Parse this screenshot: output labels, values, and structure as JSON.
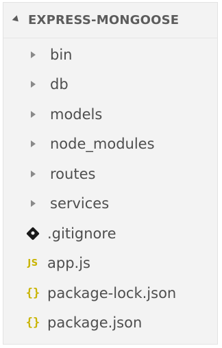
{
  "explorer": {
    "root_label": "EXPRESS-MONGOOSE",
    "items": [
      {
        "label": "bin",
        "kind": "folder",
        "icon": "chevron-right-icon"
      },
      {
        "label": "db",
        "kind": "folder",
        "icon": "chevron-right-icon"
      },
      {
        "label": "models",
        "kind": "folder",
        "icon": "chevron-right-icon"
      },
      {
        "label": "node_modules",
        "kind": "folder",
        "icon": "chevron-right-icon"
      },
      {
        "label": "routes",
        "kind": "folder",
        "icon": "chevron-right-icon"
      },
      {
        "label": "services",
        "kind": "folder",
        "icon": "chevron-right-icon"
      },
      {
        "label": ".gitignore",
        "kind": "file",
        "icon": "git-icon"
      },
      {
        "label": "app.js",
        "kind": "file",
        "icon": "js-icon",
        "icon_text": "JS"
      },
      {
        "label": "package-lock.json",
        "kind": "file",
        "icon": "json-icon",
        "icon_text": "{}"
      },
      {
        "label": "package.json",
        "kind": "file",
        "icon": "json-icon",
        "icon_text": "{}"
      }
    ]
  },
  "colors": {
    "panel_bg": "#f3f3f3",
    "text": "#4e4e4e",
    "header_text": "#5c5c5c",
    "js_yellow": "#c9b400"
  }
}
